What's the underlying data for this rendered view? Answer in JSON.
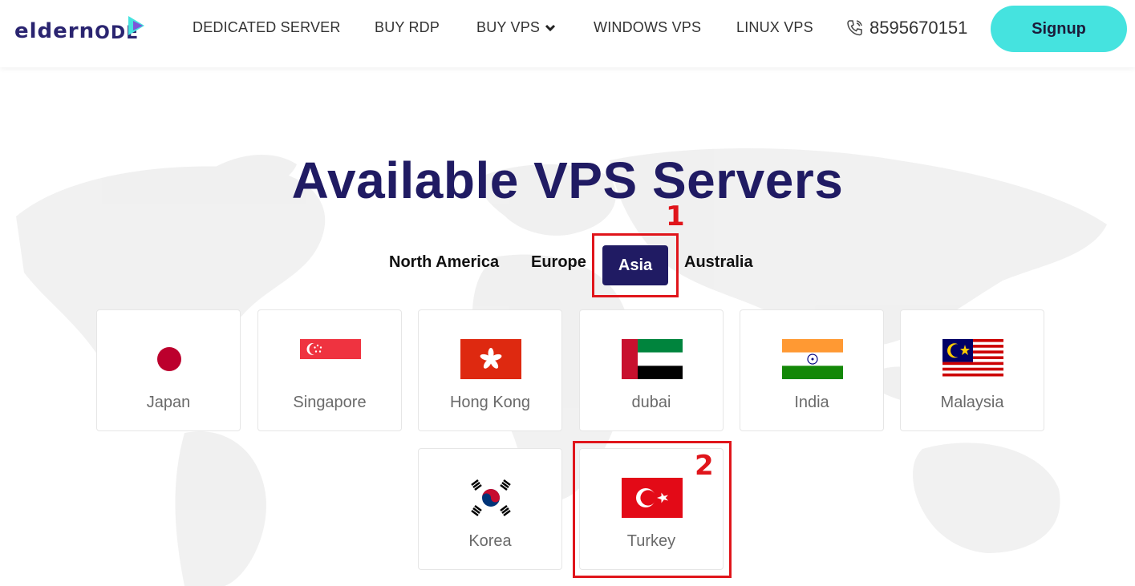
{
  "header": {
    "logo_part1": "eldern",
    "logo_part2": "ODE",
    "nav": [
      "DEDICATED SERVER",
      "BUY RDP",
      "BUY VPS",
      "WINDOWS VPS",
      "LINUX VPS"
    ],
    "phone": "8595670151",
    "signup_label": "Signup"
  },
  "main": {
    "title": "Available VPS Servers",
    "tabs": [
      {
        "label": "North America",
        "active": false
      },
      {
        "label": "Europe",
        "active": false
      },
      {
        "label": "Asia",
        "active": true
      },
      {
        "label": "Australia",
        "active": false
      }
    ],
    "countries": [
      {
        "name": "Japan",
        "flag": "japan-flag-icon"
      },
      {
        "name": "Singapore",
        "flag": "singapore-flag-icon"
      },
      {
        "name": "Hong Kong",
        "flag": "hong-kong-flag-icon"
      },
      {
        "name": "dubai",
        "flag": "uae-flag-icon"
      },
      {
        "name": "India",
        "flag": "india-flag-icon"
      },
      {
        "name": "Malaysia",
        "flag": "malaysia-flag-icon"
      },
      {
        "name": "Korea",
        "flag": "korea-flag-icon"
      },
      {
        "name": "Turkey",
        "flag": "turkey-flag-icon"
      }
    ]
  },
  "annotations": [
    "1",
    "2"
  ],
  "colors": {
    "brand": "#201b63",
    "signup": "#45e3df",
    "annotation": "#e0151b"
  }
}
